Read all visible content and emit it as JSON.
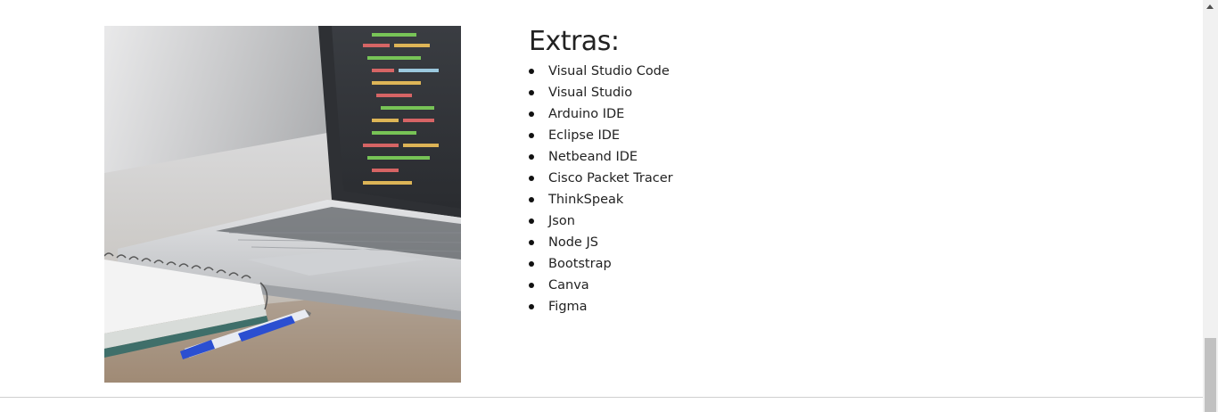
{
  "extras": {
    "title": "Extras:",
    "items": [
      "Visual Studio Code",
      "Visual Studio",
      "Arduino IDE",
      "Eclipse IDE",
      "Netbeand IDE",
      "Cisco Packet Tracer",
      "ThinkSpeak",
      "Json",
      "Node JS",
      "Bootstrap",
      "Canva",
      "Figma"
    ]
  },
  "colors": {
    "background": "#ffffff",
    "text": "#222222",
    "scrollbar_track": "#f1f1f1",
    "scrollbar_thumb": "#c1c1c1"
  },
  "icons": {
    "scroll_up": "triangle-up-icon"
  }
}
